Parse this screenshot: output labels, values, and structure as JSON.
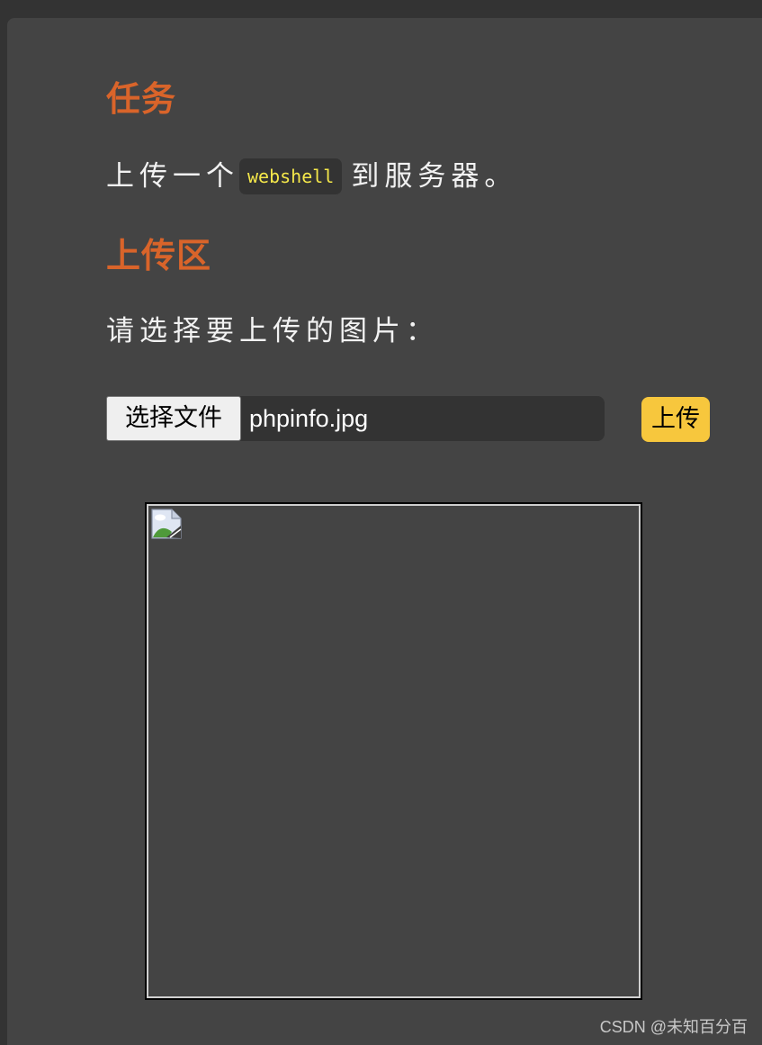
{
  "task": {
    "heading": "任务",
    "text_before": "上传一个",
    "code": "webshell",
    "text_after": "到服务器。"
  },
  "upload": {
    "heading": "上传区",
    "prompt": "请选择要上传的图片：",
    "choose_button": "选择文件",
    "file_name": "phpinfo.jpg",
    "submit_button": "上传"
  },
  "preview": {
    "icon": "broken-image-icon"
  },
  "watermark": "CSDN @未知百分百",
  "colors": {
    "heading": "#d9642a",
    "code_text": "#f5e84a",
    "submit_bg": "#f7c73d",
    "panel_bg": "#444444",
    "outer_bg": "#333333"
  }
}
